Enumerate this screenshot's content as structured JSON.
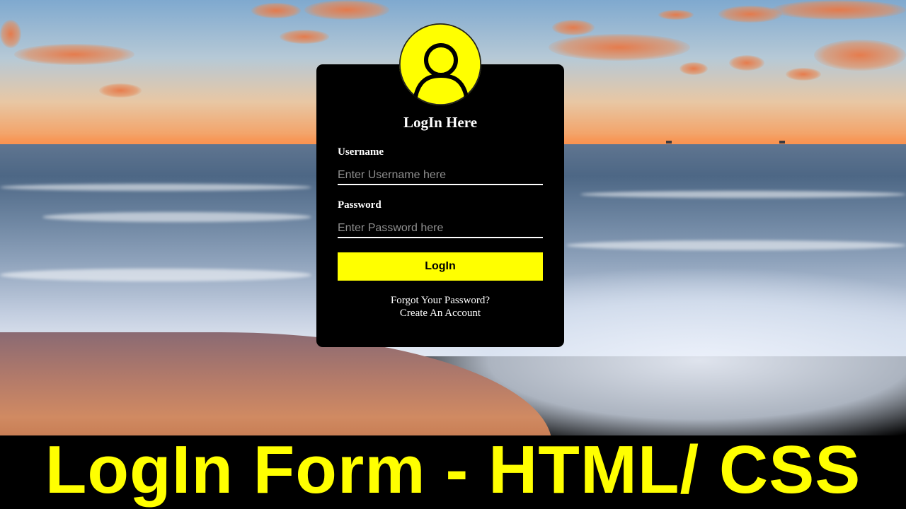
{
  "login_form": {
    "title": "LogIn Here",
    "username_label": "Username",
    "username_placeholder": "Enter Username here",
    "password_label": "Password",
    "password_placeholder": "Enter Password here",
    "login_button": "LogIn",
    "forgot_password_link": "Forgot Your Password?",
    "create_account_link": "Create An Account"
  },
  "banner": {
    "text": "LogIn Form - HTML/ CSS"
  },
  "colors": {
    "accent": "#ffff00",
    "card_background": "#000000",
    "text": "#ffffff"
  },
  "icons": {
    "avatar": "user-icon"
  }
}
